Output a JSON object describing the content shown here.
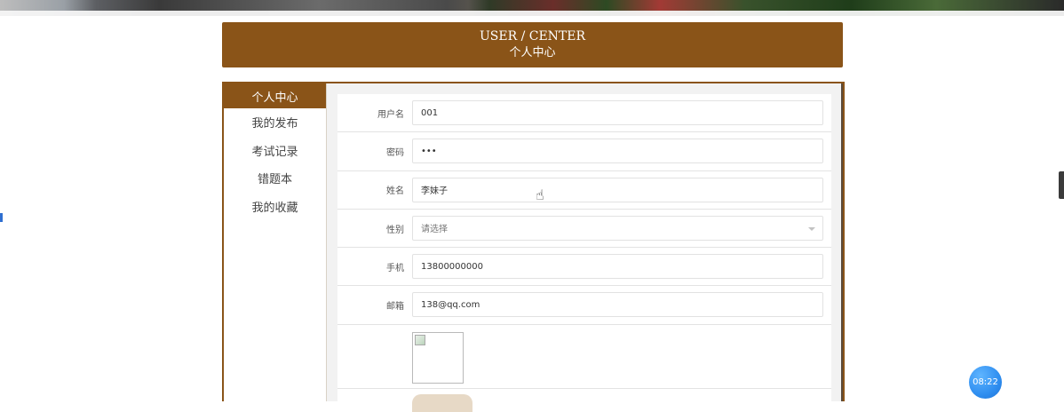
{
  "header": {
    "title_en": "USER / CENTER",
    "title_zh": "个人中心"
  },
  "sidebar": {
    "items": [
      {
        "label": "个人中心",
        "active": true
      },
      {
        "label": "我的发布",
        "active": false
      },
      {
        "label": "考试记录",
        "active": false
      },
      {
        "label": "错题本",
        "active": false
      },
      {
        "label": "我的收藏",
        "active": false
      }
    ]
  },
  "form": {
    "username": {
      "label": "用户名",
      "value": "001"
    },
    "password": {
      "label": "密码",
      "value": "•••"
    },
    "name": {
      "label": "姓名",
      "value": "李妹子"
    },
    "gender": {
      "label": "性别",
      "value": "请选择"
    },
    "phone": {
      "label": "手机",
      "value": "13800000000"
    },
    "email": {
      "label": "邮箱",
      "value": "138@qq.com"
    }
  },
  "clock": {
    "time": "08:22"
  },
  "colors": {
    "accent": "#8a5418",
    "clock": "#2f8ef0"
  },
  "icons": {
    "cursor": "hand-pointer-icon",
    "select_caret": "chevron-down-icon",
    "image": "broken-image-icon"
  }
}
